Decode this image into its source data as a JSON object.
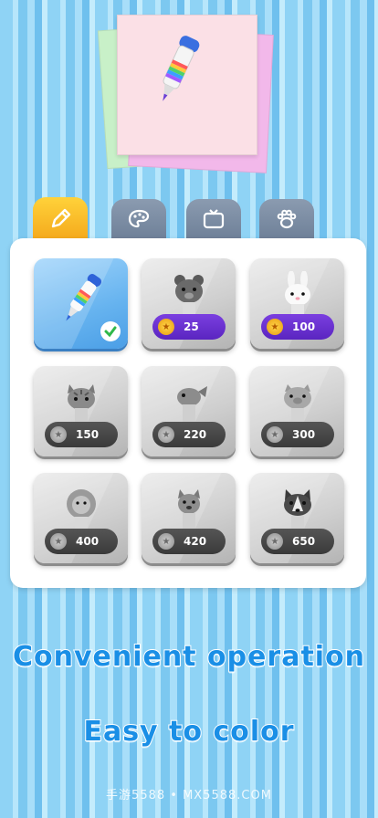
{
  "tabs": [
    {
      "icon": "pencil-icon",
      "active": true
    },
    {
      "icon": "palette-icon",
      "active": false
    },
    {
      "icon": "tv-icon",
      "active": false
    },
    {
      "icon": "paw-icon",
      "active": false
    }
  ],
  "items": [
    {
      "name": "pencil",
      "price": "",
      "selected": true
    },
    {
      "name": "bear",
      "price": "25",
      "coin": "gold"
    },
    {
      "name": "rabbit",
      "price": "100",
      "coin": "gold"
    },
    {
      "name": "cat",
      "price": "150",
      "coin": "gray"
    },
    {
      "name": "fish",
      "price": "220",
      "coin": "gray"
    },
    {
      "name": "pig",
      "price": "300",
      "coin": "gray"
    },
    {
      "name": "lion",
      "price": "400",
      "coin": "gray"
    },
    {
      "name": "dog",
      "price": "420",
      "coin": "gray"
    },
    {
      "name": "husky",
      "price": "650",
      "coin": "gray"
    }
  ],
  "headline1": "Convenient operation",
  "headline2": "Easy to color",
  "watermark": "手游5588 • MX5588.COM",
  "colors": {
    "accent": "#1a8fe6",
    "tab_active": "#f4a81b",
    "price_purple": "#5a25c0"
  }
}
